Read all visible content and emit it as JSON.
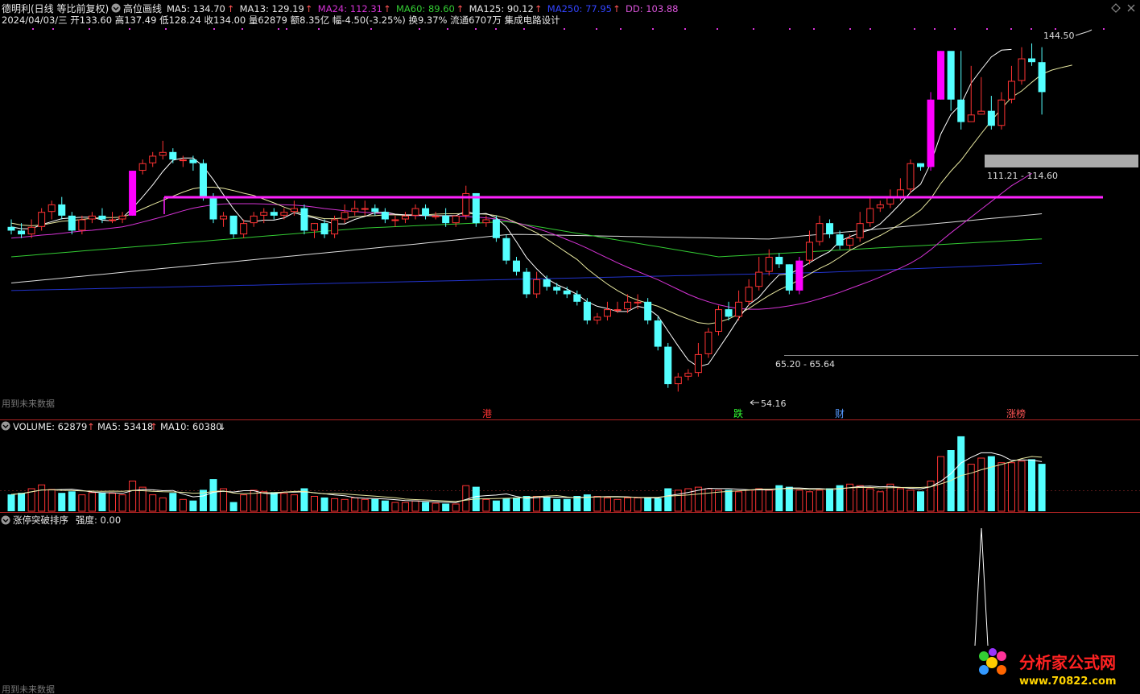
{
  "header": {
    "stock": "德明利(日线 等比前复权)",
    "formula": "高位画线",
    "ma_items": [
      {
        "label": "MA5: 134.70",
        "arrow": "↑",
        "color": "#e8e8e8"
      },
      {
        "label": "MA13: 129.19",
        "arrow": "↑",
        "color": "#e8e8e8"
      },
      {
        "label": "MA24: 112.31",
        "arrow": "↑",
        "color": "#d633d6"
      },
      {
        "label": "MA60: 89.60",
        "arrow": "↑",
        "color": "#33cc33"
      },
      {
        "label": "MA125: 90.12",
        "arrow": "↑",
        "color": "#e8e8e8"
      },
      {
        "label": "MA250: 77.95",
        "arrow": "↑",
        "color": "#3344ff"
      },
      {
        "label": "DD: 103.88",
        "arrow": "",
        "color": "#dd55dd"
      }
    ],
    "info_line": "2024/04/03/三 开133.60 高137.49 低128.24 收134.00 量62879 额8.35亿 幅-4.50(-3.25%) 换9.37% 流通6707万 集成电路设计"
  },
  "annotations": {
    "high": "144.50",
    "zone_high": "111.21 - 114.60",
    "zone_low": "65.20 - 65.64",
    "low": "54.16",
    "future_note": "用到未来数据",
    "tags": [
      {
        "text": "港",
        "color": "#ff3333"
      },
      {
        "text": "跌",
        "color": "#33ff33"
      },
      {
        "text": "财",
        "color": "#5599ff"
      },
      {
        "text": "涨榜",
        "color": "#ff5555"
      }
    ]
  },
  "volume_panel": {
    "label": "VOLUME: 62879",
    "ma5": "MA5: 53418",
    "ma10": "MA10: 60380",
    "up": "↑",
    "down": "↓"
  },
  "indicator_panel": {
    "name": "涨停突破排序",
    "value": "强度: 0.00",
    "future_note": "用到未来数据"
  },
  "watermark": {
    "name": "分析家公式网",
    "url": "www.70822.com"
  },
  "colors": {
    "up": "#ff3333",
    "down": "#54ffff",
    "limit_up": "#ff00ff",
    "ma5": "#ffffff",
    "ma13": "#e8e8a0",
    "ma24": "#d633d6",
    "ma60": "#33cc33",
    "ma125": "#dddddd",
    "ma250": "#2233cc",
    "divider": "#aa2222"
  },
  "chart_data": {
    "type": "candlestick",
    "price_range": [
      50,
      150
    ],
    "resistance_line": 113,
    "zone_high": [
      111.21,
      114.6
    ],
    "zone_low": [
      65.2,
      65.64
    ],
    "candles": [
      [
        98,
        97,
        100,
        96
      ],
      [
        97,
        96,
        99,
        95
      ],
      [
        96,
        98,
        100,
        95
      ],
      [
        98,
        102,
        103,
        97
      ],
      [
        102,
        104,
        105,
        100
      ],
      [
        104,
        101,
        106,
        100
      ],
      [
        101,
        97,
        102,
        96
      ],
      [
        97,
        100,
        101,
        96
      ],
      [
        100,
        101,
        102,
        99
      ],
      [
        101,
        100,
        103,
        99
      ],
      [
        100,
        100,
        102,
        99
      ],
      [
        100,
        101,
        102,
        99
      ],
      [
        101,
        113,
        113,
        101
      ],
      [
        113,
        115,
        116,
        112
      ],
      [
        115,
        117,
        118,
        114
      ],
      [
        117,
        118,
        121,
        116
      ],
      [
        118,
        116,
        119,
        115
      ],
      [
        116,
        116,
        117,
        114
      ],
      [
        116,
        115,
        117,
        113
      ],
      [
        115,
        106,
        116,
        105
      ],
      [
        106,
        100,
        107,
        99
      ],
      [
        100,
        101,
        102,
        98
      ],
      [
        101,
        96,
        101,
        95
      ],
      [
        96,
        99,
        100,
        95
      ],
      [
        99,
        101,
        102,
        98
      ],
      [
        101,
        102,
        103,
        99
      ],
      [
        102,
        101,
        103,
        100
      ],
      [
        101,
        102,
        103,
        100
      ],
      [
        102,
        103,
        105,
        101
      ],
      [
        103,
        97,
        104,
        96
      ],
      [
        97,
        99,
        99,
        95
      ],
      [
        99,
        96,
        100,
        95
      ],
      [
        96,
        100,
        101,
        95
      ],
      [
        100,
        102,
        104,
        99
      ],
      [
        102,
        103,
        105,
        101
      ],
      [
        103,
        103,
        105,
        101
      ],
      [
        103,
        102,
        104,
        101
      ],
      [
        102,
        100,
        103,
        99
      ],
      [
        100,
        100,
        101,
        98
      ],
      [
        100,
        101,
        102,
        99
      ],
      [
        101,
        103,
        104,
        100
      ],
      [
        103,
        101,
        104,
        100
      ],
      [
        101,
        101,
        102,
        100
      ],
      [
        101,
        99,
        103,
        98
      ],
      [
        99,
        101,
        101,
        98
      ],
      [
        101,
        107,
        109,
        100
      ],
      [
        107,
        99,
        107,
        98
      ],
      [
        99,
        100,
        101,
        98
      ],
      [
        100,
        95,
        101,
        94
      ],
      [
        95,
        89,
        96,
        88
      ],
      [
        89,
        86,
        90,
        85
      ],
      [
        86,
        80,
        87,
        79
      ],
      [
        80,
        84,
        86,
        79
      ],
      [
        84,
        82,
        85,
        81
      ],
      [
        82,
        81,
        83,
        80
      ],
      [
        81,
        80,
        82,
        79
      ],
      [
        80,
        78,
        81,
        77
      ],
      [
        78,
        73,
        79,
        72
      ],
      [
        73,
        74,
        75,
        72
      ],
      [
        74,
        76,
        78,
        73
      ],
      [
        76,
        76,
        78,
        75
      ],
      [
        76,
        78,
        80,
        75
      ],
      [
        78,
        78,
        80,
        76
      ],
      [
        78,
        73,
        79,
        72
      ],
      [
        73,
        66,
        74,
        65
      ],
      [
        66,
        56,
        67,
        55
      ],
      [
        56,
        58,
        59,
        54
      ],
      [
        58,
        59,
        60,
        57
      ],
      [
        59,
        64,
        67,
        58
      ],
      [
        64,
        70,
        71,
        63
      ],
      [
        70,
        76,
        77,
        69
      ],
      [
        76,
        74,
        78,
        73
      ],
      [
        74,
        78,
        81,
        73
      ],
      [
        78,
        82,
        84,
        77
      ],
      [
        82,
        86,
        90,
        81
      ],
      [
        86,
        90,
        92,
        85
      ],
      [
        90,
        88,
        91,
        87
      ],
      [
        88,
        81,
        88,
        80
      ],
      [
        81,
        89,
        90,
        80
      ],
      [
        89,
        94,
        97,
        88
      ],
      [
        94,
        99,
        101,
        93
      ],
      [
        99,
        96,
        100,
        95
      ],
      [
        96,
        93,
        97,
        92
      ],
      [
        93,
        95,
        96,
        92
      ],
      [
        95,
        99,
        102,
        94
      ],
      [
        99,
        103,
        106,
        98
      ],
      [
        103,
        104,
        105,
        102
      ],
      [
        104,
        106,
        108,
        103
      ],
      [
        106,
        108,
        111,
        105
      ],
      [
        108,
        115,
        116,
        107
      ],
      [
        115,
        114,
        115,
        113
      ],
      [
        114,
        132,
        134,
        113
      ],
      [
        132,
        145,
        145,
        132
      ],
      [
        145,
        132,
        144,
        129
      ],
      [
        132,
        126,
        145,
        124
      ],
      [
        126,
        128,
        141,
        127
      ],
      [
        128,
        129,
        138,
        128
      ],
      [
        129,
        125,
        133,
        124
      ],
      [
        125,
        132,
        134,
        124
      ],
      [
        132,
        137,
        141,
        131
      ],
      [
        137,
        143,
        146,
        136
      ],
      [
        143,
        142,
        147,
        141
      ],
      [
        142,
        134,
        146,
        128
      ]
    ],
    "ma5": [
      98,
      97.5,
      97.5,
      98.6,
      99.4,
      100.2,
      100.4,
      100.6,
      100.6,
      99.8,
      99.6,
      100.4,
      103,
      106,
      109.2,
      112.8,
      115.8,
      116.4,
      116.4,
      114.2,
      110.6,
      106.6,
      102.8,
      99.6,
      99.4,
      99.8,
      99.8,
      100.4,
      101.8,
      101,
      100.4,
      99.6,
      98.8,
      98.8,
      100,
      100.8,
      101.8,
      102,
      101.4,
      101.2,
      101.2,
      101,
      101,
      101,
      101,
      102.2,
      101.4,
      101.6,
      100.4,
      98,
      94,
      89.8,
      86.8,
      84.2,
      82.6,
      81.4,
      80,
      78,
      76.8,
      76.2,
      75.4,
      75.4,
      76.8,
      76.2,
      74.2,
      70.2,
      66.2,
      62.4,
      60.6,
      61.4,
      65.4,
      69.4,
      73.6,
      77.2,
      79.2,
      82.4,
      85.2,
      85.4,
      86.8,
      88.4,
      90,
      91.4,
      94.2,
      95.4,
      96.4,
      97.2,
      98.8,
      101.4,
      104.2,
      107.2,
      109.4,
      115,
      122.8,
      128,
      130.8,
      136.4,
      140,
      143.4,
      145.2,
      145.4
    ],
    "ma13": [
      99,
      98.5,
      98.3,
      98.5,
      99,
      99.5,
      99.7,
      100,
      100.3,
      100.5,
      100.5,
      100.6,
      101.6,
      102.8,
      104,
      105.1,
      106.2,
      107.3,
      108.2,
      108.6,
      108.6,
      108.3,
      107.7,
      107,
      106.4,
      105.4,
      104.4,
      103.3,
      102.3,
      101.3,
      100.7,
      100.2,
      100.2,
      100.4,
      100.7,
      100.9,
      101,
      101.2,
      101.2,
      101.1,
      101.1,
      101.2,
      101.4,
      101.5,
      101.5,
      101.6,
      101.5,
      101.4,
      101,
      100.3,
      99.1,
      97.7,
      96.4,
      94.7,
      92.9,
      91.1,
      89.3,
      86.8,
      84.7,
      82.7,
      81,
      79.5,
      78.4,
      77.6,
      76.8,
      75.6,
      74.4,
      73.4,
      72.4,
      72.1,
      72.5,
      73.4,
      74.7,
      76.2,
      78,
      79.7,
      81.2,
      82.4,
      83.9,
      85.4,
      86.9,
      88.2,
      89.9,
      91.7,
      93.1,
      94.4,
      95.7,
      97.2,
      98.8,
      100.6,
      102.5,
      105.5,
      109.6,
      112.9,
      115.8,
      119.4,
      122.9,
      126.3,
      129.6,
      132.6,
      134.3,
      136.6,
      138.8,
      139.9,
      140.6,
      141.2
    ],
    "ma24": [
      95,
      95.2,
      95.5,
      95.8,
      96,
      96.3,
      96.6,
      96.9,
      97.1,
      97.4,
      97.7,
      98,
      98.6,
      99.3,
      100,
      100.7,
      101.5,
      102.3,
      103,
      103.5,
      103.9,
      104.1,
      104.2,
      104.2,
      104.2,
      104.1,
      104,
      103.9,
      103.8,
      103.6,
      103.3,
      102.9,
      102.6,
      102.3,
      102.1,
      101.9,
      101.7,
      101.5,
      101.3,
      101.1,
      101,
      101,
      101,
      100.9,
      100.9,
      100.8,
      100.6,
      100.4,
      100.1,
      99.7,
      99.1,
      98.4,
      97.6,
      96.7,
      95.7,
      94.6,
      93.5,
      92.3,
      91,
      89.7,
      88.4,
      87.2,
      86.1,
      85,
      83.9,
      82.6,
      81.3,
      80,
      78.9,
      78,
      77.2,
      76.6,
      76.2,
      76,
      76,
      76.2,
      76.5,
      76.9,
      77.4,
      78,
      78.8,
      79.6,
      80.5,
      81.5,
      82.5,
      83.5,
      84.6,
      85.8,
      87,
      88.3,
      89.9,
      91.9,
      94.2,
      96.4,
      98.5,
      100.6,
      102.7,
      104.8,
      106.9,
      109,
      110.6,
      112.3
    ]
  }
}
